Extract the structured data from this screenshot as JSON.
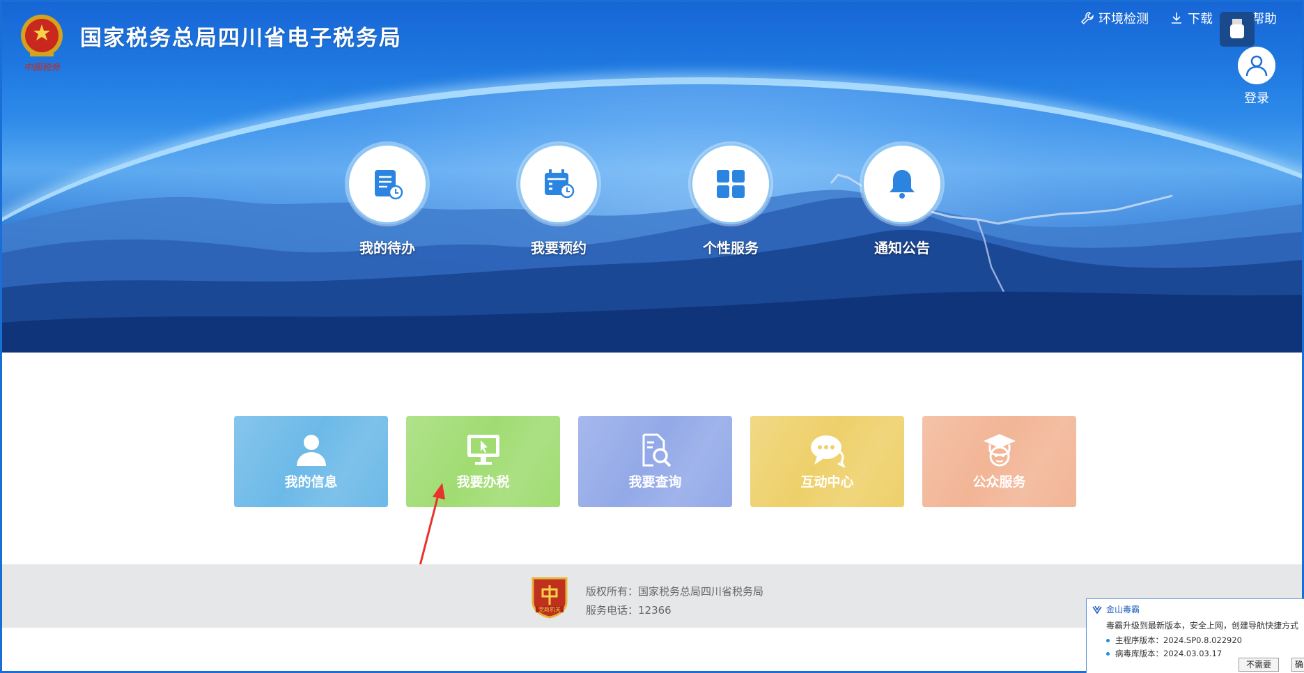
{
  "header": {
    "title": "国家税务总局四川省电子税务局",
    "logo_caption": "中国税务",
    "links": [
      {
        "label": "环境检测",
        "icon": "wrench-icon"
      },
      {
        "label": "下载",
        "icon": "download-icon"
      },
      {
        "label": "帮助",
        "icon": "help-icon"
      }
    ],
    "login_label": "登录"
  },
  "quick_actions": [
    {
      "label": "我的待办",
      "icon": "todo-list-icon"
    },
    {
      "label": "我要预约",
      "icon": "calendar-clock-icon"
    },
    {
      "label": "个性服务",
      "icon": "grid-icon"
    },
    {
      "label": "通知公告",
      "icon": "bell-icon"
    }
  ],
  "tiles": [
    {
      "label": "我的信息",
      "icon": "user-icon",
      "color": "#6cb9e8"
    },
    {
      "label": "我要办税",
      "icon": "monitor-cursor-icon",
      "color": "#a0dc72"
    },
    {
      "label": "我要查询",
      "icon": "document-search-icon",
      "color": "#93a9e8"
    },
    {
      "label": "互动中心",
      "icon": "chat-bubble-icon",
      "color": "#eed06a"
    },
    {
      "label": "公众服务",
      "icon": "graduate-icon",
      "color": "#f2b596"
    }
  ],
  "footer": {
    "copyright": "版权所有：国家税务总局四川省税务局",
    "phone": "服务电话：12366",
    "badge_text": "党政机关"
  },
  "popup": {
    "app_name": "金山毒霸",
    "message": "毒霸升级到最新版本，安全上网，创建导航快捷方式",
    "main_version": "主程序版本：2024.SP0.8.022920",
    "db_version": "病毒库版本：2024.03.03.17",
    "btn_decline": "不需要",
    "btn_confirm": "确"
  },
  "colors": {
    "hero_blue": "#1766d6",
    "footer_gray": "#e6e7e9",
    "annotation_arrow": "#e8322b"
  }
}
